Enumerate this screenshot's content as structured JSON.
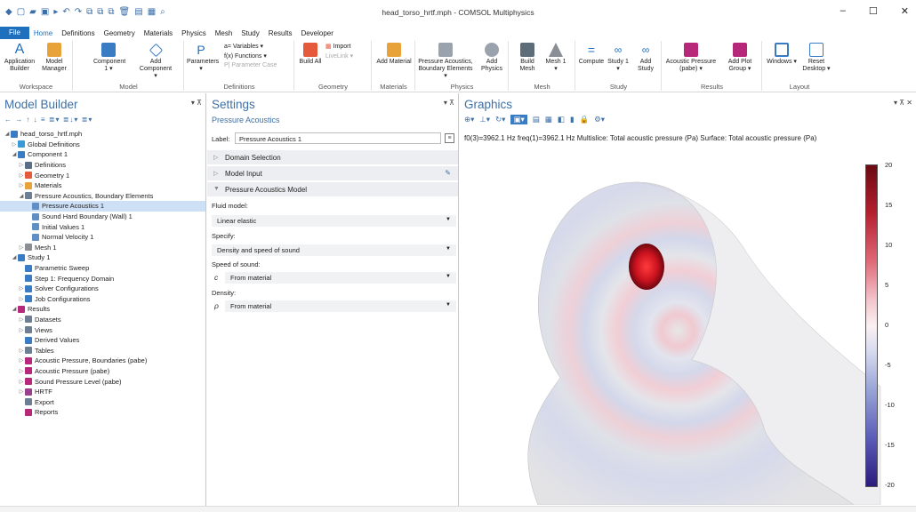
{
  "window": {
    "title": "head_torso_hrtf.mph - COMSOL Multiphysics",
    "minimize": "–",
    "maximize": "☐",
    "close": "✕"
  },
  "menu": {
    "file": "File",
    "tabs": [
      "Home",
      "Definitions",
      "Geometry",
      "Materials",
      "Physics",
      "Mesh",
      "Study",
      "Results",
      "Developer"
    ],
    "active": "Home"
  },
  "ribbon": {
    "groups": {
      "workspace": "Workspace",
      "model": "Model",
      "definitions": "Definitions",
      "geometry": "Geometry",
      "materials": "Materials",
      "physics": "Physics",
      "mesh": "Mesh",
      "study": "Study",
      "results": "Results",
      "layout": "Layout"
    },
    "buttons": {
      "application_builder": "Application Builder",
      "model_manager": "Model Manager",
      "component": "Component 1 ▾",
      "add_component": "Add Component ▾",
      "parameters": "Parameters ▾",
      "variables": "a= Variables ▾",
      "functions": "f(x) Functions ▾",
      "parameter_case": "P| Parameter Case",
      "build_all": "Build All",
      "import": "Import",
      "livelink": "LiveLink ▾",
      "add_material": "Add Material",
      "pressure_acoustics": "Pressure Acoustics, Boundary Elements ▾",
      "add_physics": "Add Physics",
      "build_mesh": "Build Mesh",
      "mesh1": "Mesh 1 ▾",
      "compute": "Compute",
      "study1": "Study 1 ▾",
      "add_study": "Add Study",
      "acoustic_pressure": "Acoustic Pressure (pabe) ▾",
      "add_plot_group": "Add Plot Group ▾",
      "windows": "Windows ▾",
      "reset_desktop": "Reset Desktop ▾"
    }
  },
  "model_builder": {
    "title": "Model Builder",
    "toolbar": "← → ↑ ↓ ≡ ≣▾ ≣↓▾ ≣▾",
    "tree": [
      {
        "label": "head_torso_hrtf.mph",
        "level": 0,
        "arrow": "◢",
        "icon": "root"
      },
      {
        "label": "Global Definitions",
        "level": 1,
        "arrow": "▷",
        "icon": "globe"
      },
      {
        "label": "Component 1",
        "level": 1,
        "arrow": "◢",
        "icon": "component"
      },
      {
        "label": "Definitions",
        "level": 2,
        "arrow": "▷",
        "icon": "defs"
      },
      {
        "label": "Geometry 1",
        "level": 2,
        "arrow": "▷",
        "icon": "geometry"
      },
      {
        "label": "Materials",
        "level": 2,
        "arrow": "▷",
        "icon": "materials"
      },
      {
        "label": "Pressure Acoustics, Boundary Elements",
        "level": 2,
        "arrow": "◢",
        "icon": "physics"
      },
      {
        "label": "Pressure Acoustics 1",
        "level": 3,
        "arrow": "",
        "icon": "node",
        "selected": true
      },
      {
        "label": "Sound Hard Boundary (Wall) 1",
        "level": 3,
        "arrow": "",
        "icon": "node"
      },
      {
        "label": "Initial Values 1",
        "level": 3,
        "arrow": "",
        "icon": "node"
      },
      {
        "label": "Normal Velocity 1",
        "level": 3,
        "arrow": "",
        "icon": "node"
      },
      {
        "label": "Mesh 1",
        "level": 2,
        "arrow": "▷",
        "icon": "mesh"
      },
      {
        "label": "Study 1",
        "level": 1,
        "arrow": "◢",
        "icon": "study"
      },
      {
        "label": "Parametric Sweep",
        "level": 2,
        "arrow": "",
        "icon": "sweep"
      },
      {
        "label": "Step 1: Frequency Domain",
        "level": 2,
        "arrow": "",
        "icon": "step"
      },
      {
        "label": "Solver Configurations",
        "level": 2,
        "arrow": "▷",
        "icon": "solver"
      },
      {
        "label": "Job Configurations",
        "level": 2,
        "arrow": "▷",
        "icon": "job"
      },
      {
        "label": "Results",
        "level": 1,
        "arrow": "◢",
        "icon": "results"
      },
      {
        "label": "Datasets",
        "level": 2,
        "arrow": "▷",
        "icon": "datasets"
      },
      {
        "label": "Views",
        "level": 2,
        "arrow": "▷",
        "icon": "views"
      },
      {
        "label": "Derived Values",
        "level": 2,
        "arrow": "",
        "icon": "derived"
      },
      {
        "label": "Tables",
        "level": 2,
        "arrow": "▷",
        "icon": "tables"
      },
      {
        "label": "Acoustic Pressure, Boundaries (pabe)",
        "level": 2,
        "arrow": "▷",
        "icon": "plot"
      },
      {
        "label": "Acoustic Pressure (pabe)",
        "level": 2,
        "arrow": "▷",
        "icon": "plot"
      },
      {
        "label": "Sound Pressure Level (pabe)",
        "level": 2,
        "arrow": "▷",
        "icon": "plot"
      },
      {
        "label": "HRTF",
        "level": 2,
        "arrow": "▷",
        "icon": "hrtf"
      },
      {
        "label": "Export",
        "level": 2,
        "arrow": "",
        "icon": "export"
      },
      {
        "label": "Reports",
        "level": 2,
        "arrow": "",
        "icon": "reports"
      }
    ]
  },
  "settings": {
    "title": "Settings",
    "subtitle": "Pressure Acoustics",
    "label_caption": "Label:",
    "label_value": "Pressure Acoustics 1",
    "sections": {
      "domain_selection": "Domain Selection",
      "model_input": "Model Input",
      "pressure_acoustics_model": "Pressure Acoustics Model"
    },
    "fluid_model_label": "Fluid model:",
    "fluid_model_value": "Linear elastic",
    "specify_label": "Specify:",
    "specify_value": "Density and speed of sound",
    "speed_label": "Speed of sound:",
    "speed_symbol": "c",
    "speed_value": "From material",
    "density_label": "Density:",
    "density_symbol": "ρ",
    "density_value": "From material"
  },
  "graphics": {
    "title": "Graphics",
    "caption": "f0(3)=3962.1 Hz freq(1)=3962.1 Hz   Multislice: Total acoustic pressure (Pa)  Surface: Total acoustic pressure (Pa)",
    "colorbar_ticks": [
      "20",
      "15",
      "10",
      "5",
      "0",
      "-5",
      "-10",
      "-15",
      "-20"
    ]
  }
}
